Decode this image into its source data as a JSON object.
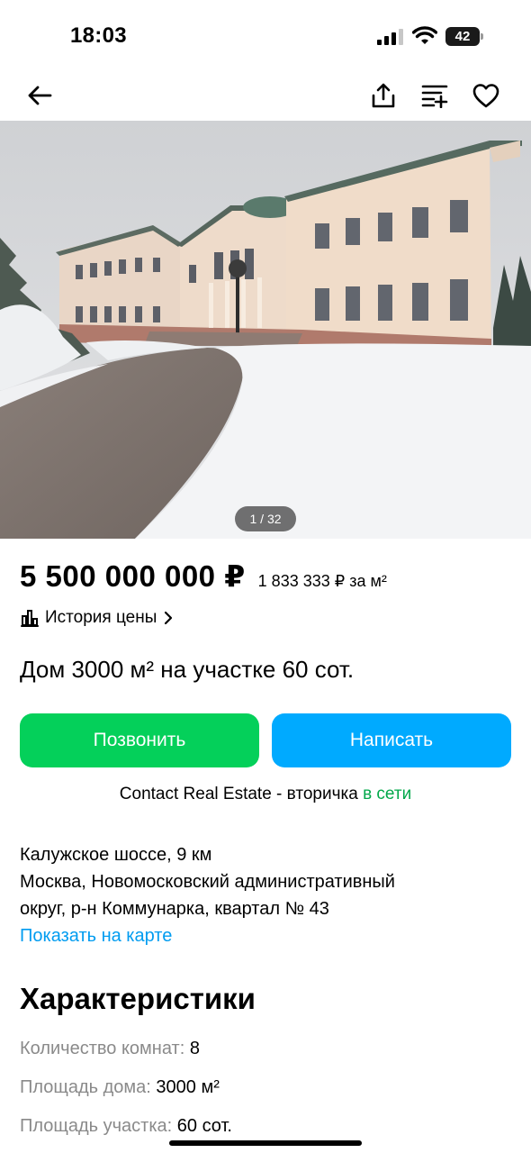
{
  "status_bar": {
    "time": "18:03",
    "battery": "42",
    "battery_level": 0.42
  },
  "nav": {
    "back_icon": "arrow-left-icon",
    "share_icon": "share-icon",
    "compare_icon": "compare-icon",
    "favorite_icon": "heart-icon"
  },
  "gallery": {
    "counter": "1 / 32"
  },
  "listing": {
    "price": "5 500 000 000 ₽",
    "price_per_m2": "1 833 333 ₽ за м²",
    "price_history_label": "История цены",
    "title": "Дом 3000 м² на участке 60 сот."
  },
  "actions": {
    "call_label": "Позвонить",
    "write_label": "Написать",
    "call_color": "#04d05a",
    "write_color": "#00aaff"
  },
  "seller": {
    "name": "Contact Real Estate - вторичка",
    "status": "в сети"
  },
  "address": {
    "highway": "Калужское шоссе, 9 км",
    "line1": "Москва, Новомосковский административный",
    "line2": "округ, р-н Коммунарка, квартал № 43",
    "map_link": "Показать на карте"
  },
  "characteristics": {
    "title": "Характеристики",
    "items": [
      {
        "label": "Количество комнат:",
        "value": "8"
      },
      {
        "label": "Площадь дома:",
        "value": "3000 м²"
      },
      {
        "label": "Площадь участка:",
        "value": "60 сот."
      }
    ]
  }
}
